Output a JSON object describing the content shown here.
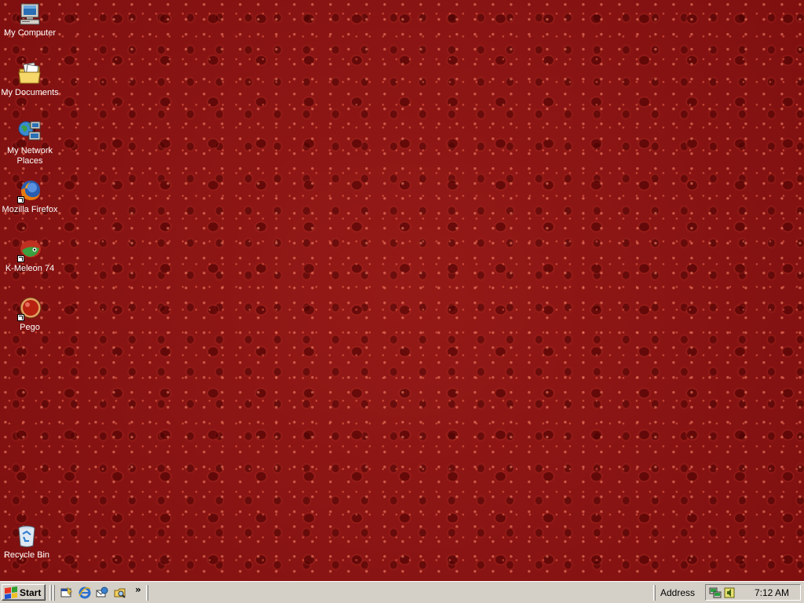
{
  "desktop": {
    "background_color": "#8c1414",
    "icons": [
      {
        "label": "My Computer",
        "icon": "my-computer-icon"
      },
      {
        "label": "My Documents",
        "icon": "my-documents-icon"
      },
      {
        "label": "My Network Places",
        "icon": "network-places-icon"
      },
      {
        "label": "Mozilla Firefox",
        "icon": "firefox-icon"
      },
      {
        "label": "K-Meleon 74",
        "icon": "k-meleon-icon"
      },
      {
        "label": "Pego",
        "icon": "pego-icon"
      },
      {
        "label": "Recycle Bin",
        "icon": "recycle-bin-icon"
      }
    ]
  },
  "taskbar": {
    "start_label": "Start",
    "quick_launch": [
      "show-desktop-icon",
      "internet-explorer-icon",
      "outlook-express-icon",
      "windows-explorer-icon"
    ],
    "chevron": "»",
    "address_label": "Address",
    "clock": "7:12 AM",
    "tray_icons": [
      "network-tray-icon",
      "volume-tray-icon"
    ]
  }
}
